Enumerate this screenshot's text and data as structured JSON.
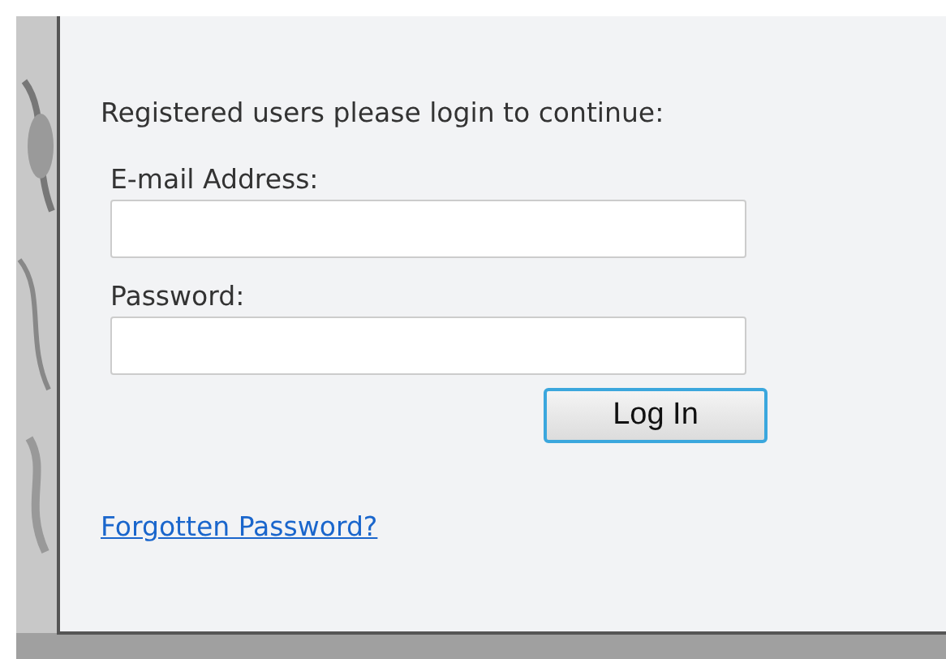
{
  "intro": "Registered users please login to continue:",
  "fields": [
    {
      "label": "E-mail Address:"
    },
    {
      "label": "Password:"
    }
  ],
  "button": "Log In",
  "link": "Forgotten Password?"
}
